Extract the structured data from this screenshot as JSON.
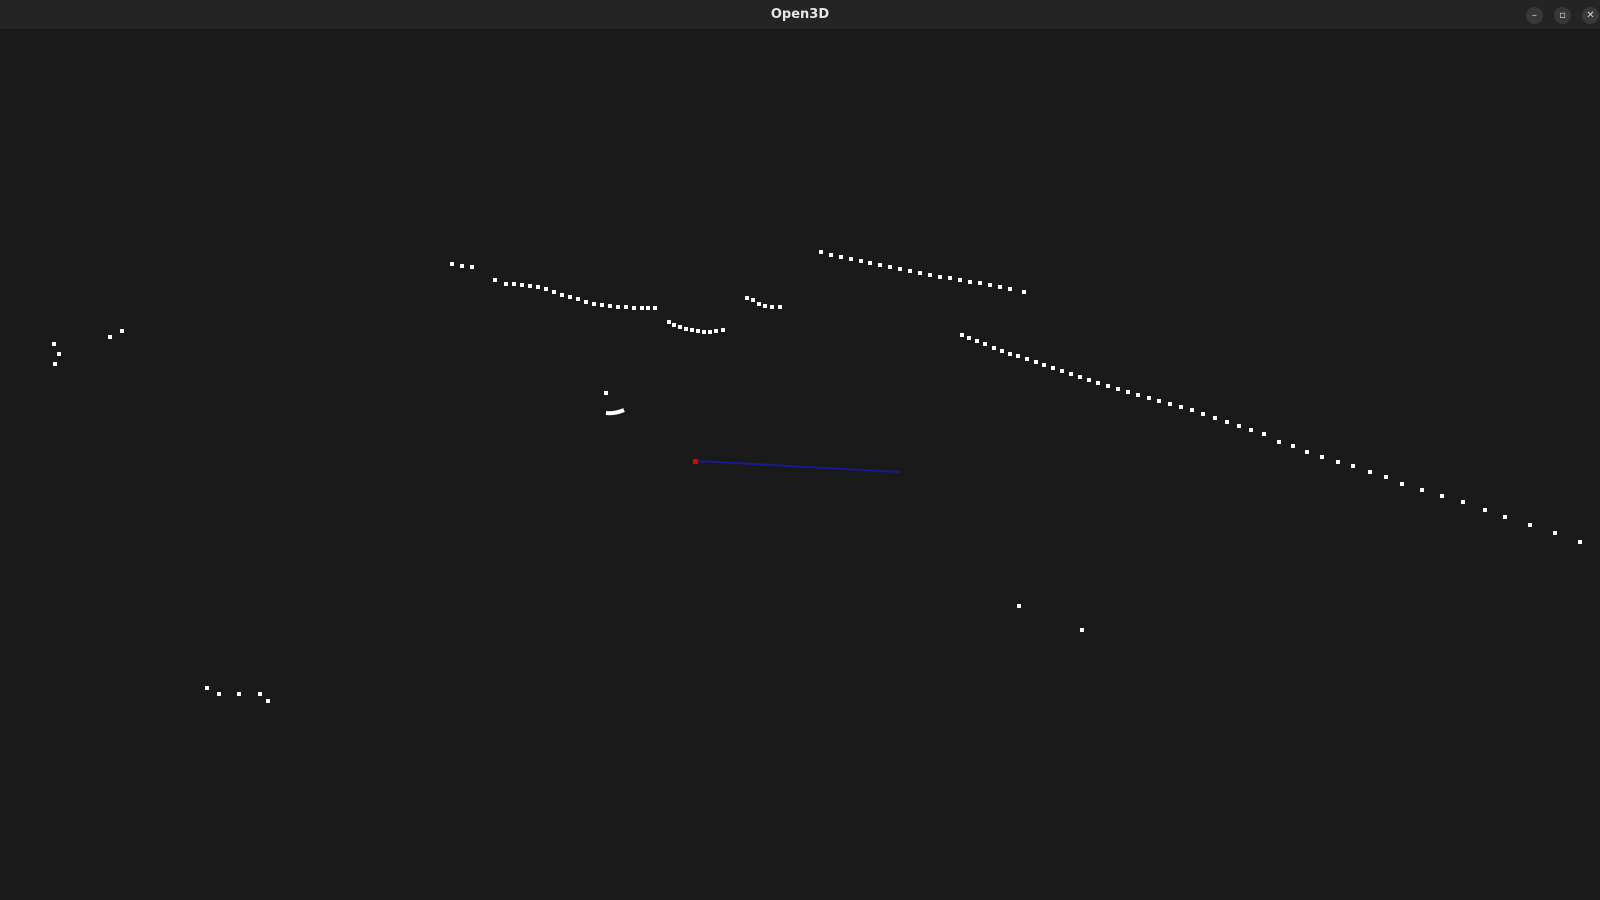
{
  "window": {
    "title": "Open3D",
    "buttons": {
      "minimize_glyph": "–",
      "maximize_glyph": "▫",
      "close_glyph": "✕"
    }
  },
  "viewport": {
    "background": "#1a1a1a",
    "point_color": "#ffffff",
    "axis_origin_color": "#e00000",
    "axis_line_color": "#1a1a8c"
  }
}
